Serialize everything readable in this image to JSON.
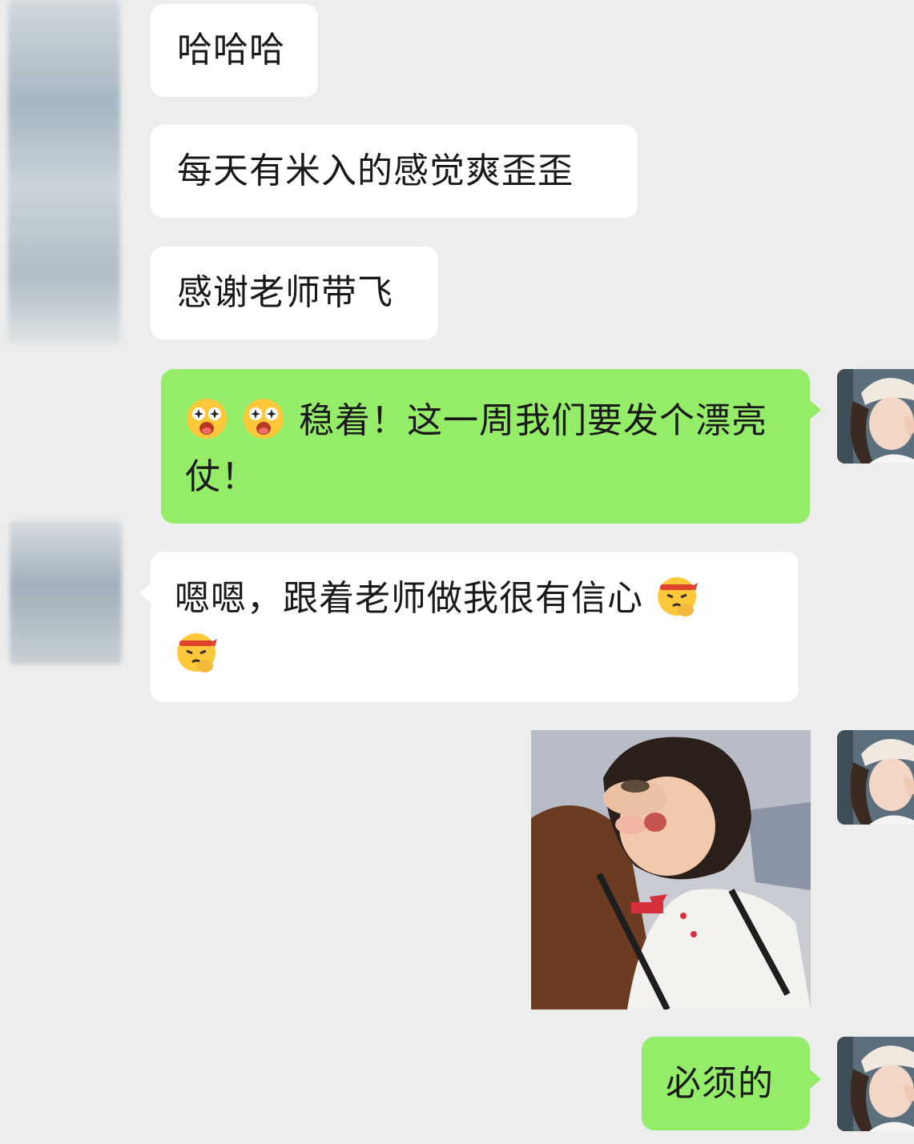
{
  "messages": [
    {
      "side": "in",
      "text": "哈哈哈"
    },
    {
      "side": "in",
      "text": "每天有米入的感觉爽歪歪"
    },
    {
      "side": "in",
      "text": "感谢老师带飞"
    },
    {
      "side": "out",
      "emoji_prefix": [
        "star-struck-emoji",
        "star-struck-emoji"
      ],
      "text": "稳着！这一周我们要发个漂亮仗！"
    },
    {
      "side": "in",
      "text": "嗯嗯，跟着老师做我很有信心",
      "emoji_suffix": [
        "determined-face-emoji",
        "determined-face-emoji"
      ]
    },
    {
      "side": "out",
      "type": "image",
      "description_icon": "meme-photo"
    },
    {
      "side": "out",
      "text": "必须的"
    }
  ],
  "colors": {
    "background": "#ededed",
    "incoming_bubble": "#ffffff",
    "outgoing_bubble": "#95ec69"
  }
}
